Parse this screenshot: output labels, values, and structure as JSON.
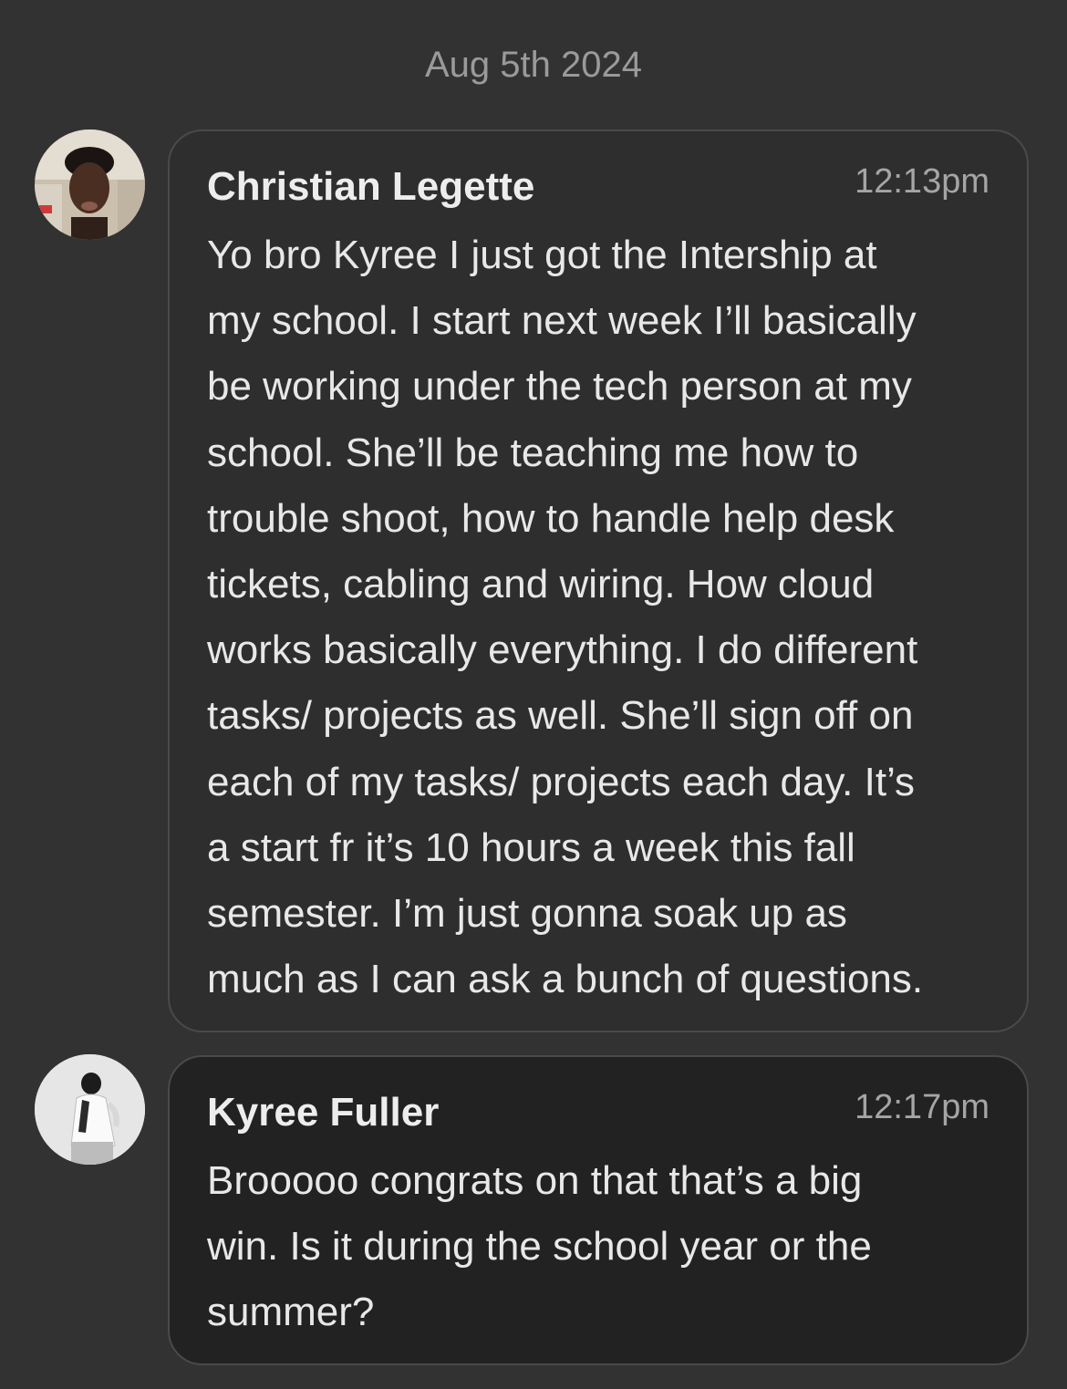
{
  "date_header": "Aug 5th 2024",
  "messages": [
    {
      "sender": "Christian Legette",
      "time": "12:13pm",
      "text": "Yo bro Kyree I just got the Intership at\nmy school. I start next week I’ll basically\nbe working under the tech person at my\nschool. She’ll be teaching me how to\ntrouble shoot, how to handle help desk\ntickets, cabling and wiring. How cloud\nworks basically everything. I do different\ntasks/ projects as well. She’ll sign off on\neach of my tasks/ projects each day. It’s\na start fr it’s 10 hours a week this fall\nsemester. I’m just gonna soak up as\nmuch as I can ask a bunch of questions."
    },
    {
      "sender": "Kyree Fuller",
      "time": "12:17pm",
      "text": "Brooooo congrats on that that’s a big\nwin. Is it during the school year or the\nsummer?"
    }
  ]
}
